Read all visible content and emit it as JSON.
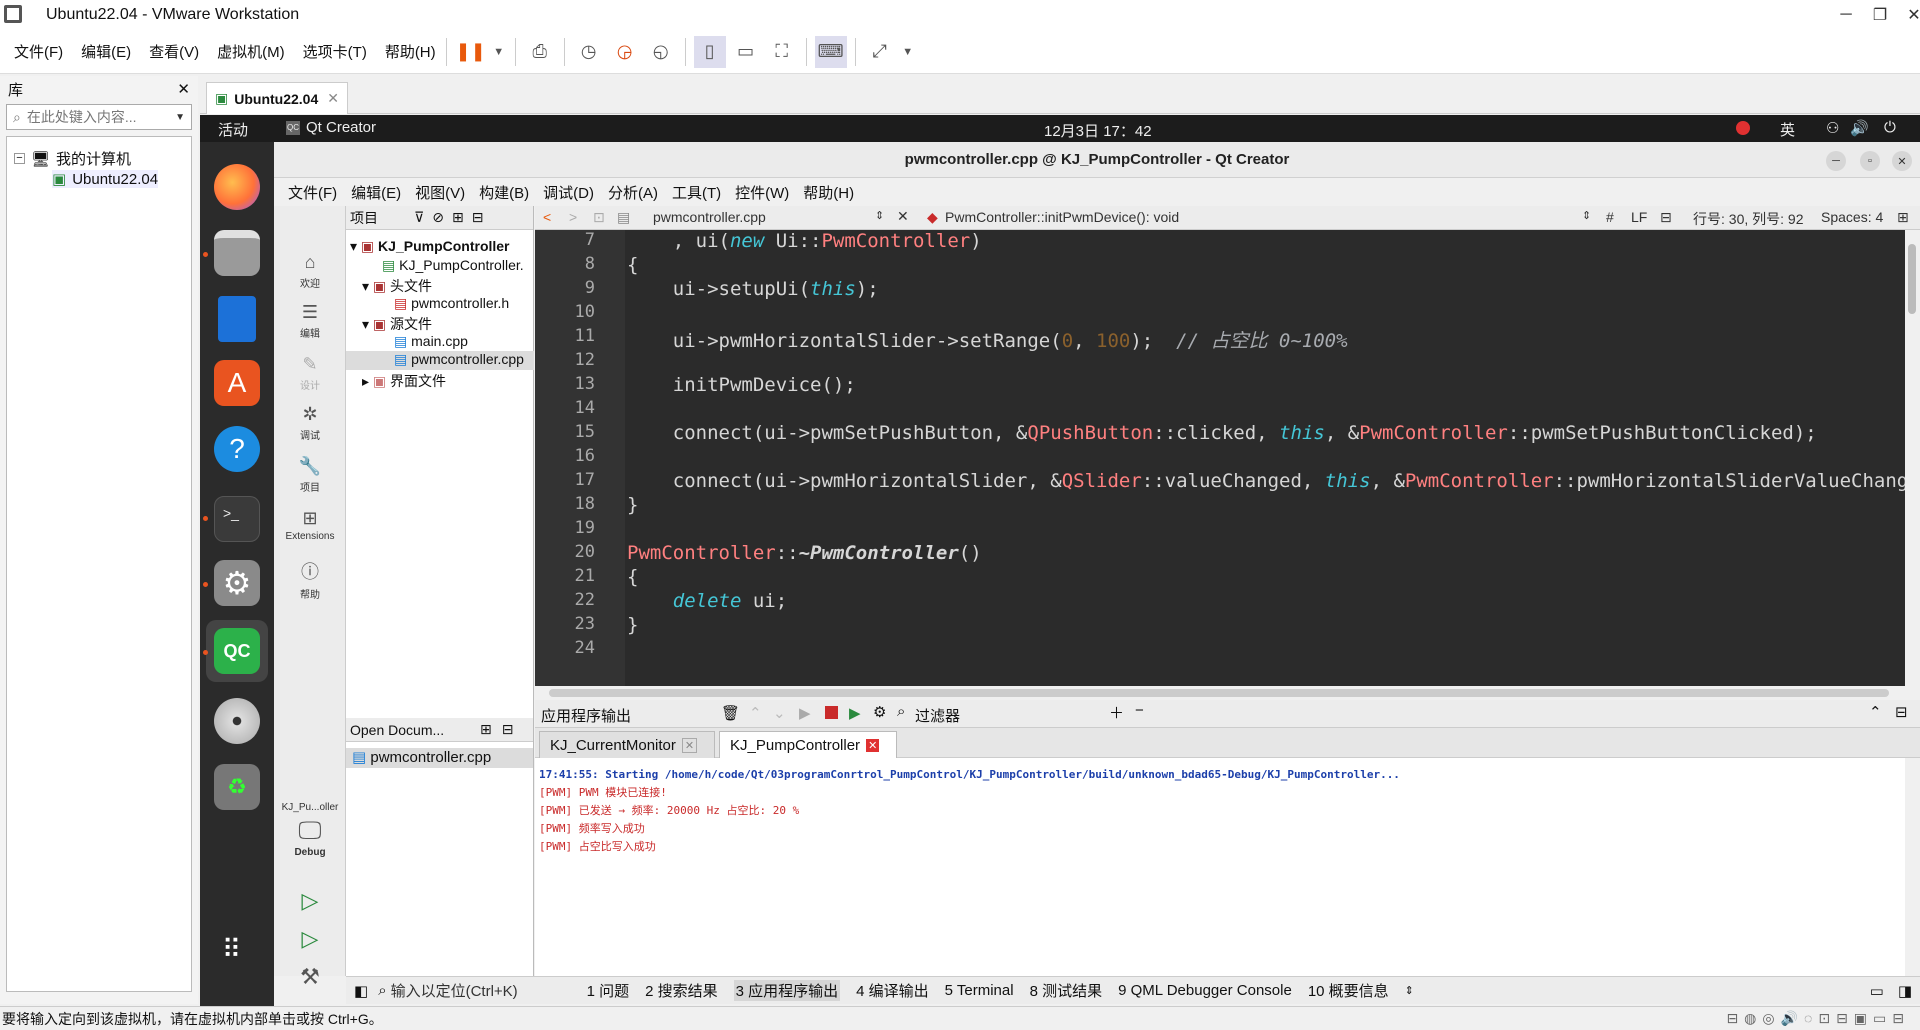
{
  "vmware": {
    "title": "Ubuntu22.04 - VMware Workstation",
    "menu": [
      "文件(F)",
      "编辑(E)",
      "查看(V)",
      "虚拟机(M)",
      "选项卡(T)",
      "帮助(H)"
    ],
    "library": {
      "title": "库",
      "search_placeholder": "在此处键入内容...",
      "tree_root": "我的计算机",
      "tree_child": "Ubuntu22.04"
    },
    "tab_label": "Ubuntu22.04",
    "status_text": "要将输入定向到该虚拟机，请在虚拟机内部单击或按 Ctrl+G。"
  },
  "gnome": {
    "activities": "活动",
    "app_name": "Qt Creator",
    "clock": "12月3日  17：42",
    "lang": "英"
  },
  "qt": {
    "title": "pwmcontroller.cpp @ KJ_PumpController - Qt Creator",
    "menu": [
      "文件(F)",
      "编辑(E)",
      "视图(V)",
      "构建(B)",
      "调试(D)",
      "分析(A)",
      "工具(T)",
      "控件(W)",
      "帮助(H)"
    ],
    "modes": [
      "欢迎",
      "编辑",
      "设计",
      "调试",
      "项目",
      "Extensions",
      "帮助"
    ],
    "project_label": "项目",
    "tree": {
      "root": "KJ_PumpController",
      "pro": "KJ_PumpController.",
      "headers": "头文件",
      "header_file": "pwmcontroller.h",
      "sources": "源文件",
      "main": "main.cpp",
      "pwmcpp": "pwmcontroller.cpp",
      "forms": "界面文件"
    },
    "open_docs_label": "Open Docum...",
    "open_doc": "pwmcontroller.cpp",
    "kit_name": "KJ_Pu...oller",
    "kit_mode": "Debug",
    "editor": {
      "file": "pwmcontroller.cpp",
      "symbol": "PwmController::initPwmDevice(): void",
      "hash": "#",
      "eol": "LF",
      "position": "行号: 30, 列号: 92",
      "spaces": "Spaces: 4"
    },
    "code": {
      "line_numbers": [
        "7",
        "8",
        "9",
        "10",
        "11",
        "12",
        "13",
        "14",
        "15",
        "16",
        "17",
        "18",
        "19",
        "20",
        "21",
        "22",
        "23",
        "24"
      ],
      "l7a": "    , ui(",
      "l7kw": "new",
      "l7b": " Ui::",
      "l7ty": "PwmController",
      "l7c": ")",
      "l8": "{",
      "l9a": "    ui->setupUi(",
      "l9kw": "this",
      "l9b": ");",
      "l11a": "    ui->pwmHorizontalSlider->setRange(",
      "l11n1": "0",
      "l11b": ", ",
      "l11n2": "100",
      "l11c": ");  ",
      "l11cm": "// 占空比 0~100%",
      "l13": "    initPwmDevice();",
      "l15a": "    connect(ui->pwmSetPushButton, &",
      "l15ty": "QPushButton",
      "l15b": "::clicked, ",
      "l15kw": "this",
      "l15c": ", &",
      "l15ty2": "PwmController",
      "l15d": "::pwmSetPushButtonClicked);",
      "l17a": "    connect(ui->pwmHorizontalSlider, &",
      "l17ty": "QSlider",
      "l17b": "::valueChanged, ",
      "l17kw": "this",
      "l17c": ", &",
      "l17ty2": "PwmController",
      "l17d": "::pwmHorizontalSliderValueChang",
      "l18": "}",
      "l20ty": "PwmController",
      "l20a": "::",
      "l20fn": "~PwmController",
      "l20b": "()",
      "l21": "{",
      "l22kw": "    delete",
      "l22a": " ui;",
      "l23": "}"
    },
    "output": {
      "pane_title": "应用程序输出",
      "filter": "过滤器",
      "tabs": [
        "KJ_CurrentMonitor",
        "KJ_PumpController"
      ],
      "lines": [
        "17:41:55: Starting /home/h/code/Qt/03programConrtrol_PumpControl/KJ_PumpController/build/unknown_bdad65-Debug/KJ_PumpController...",
        "[PWM] PWM 模块已连接!",
        "[PWM] 已发送 → 频率: 20000 Hz 占空比: 20 %",
        "[PWM] 频率写入成功",
        "[PWM] 占空比写入成功"
      ]
    },
    "locator_placeholder": "输入以定位(Ctrl+K)",
    "status_tabs": [
      "1 问题",
      "2 搜索结果",
      "3 应用程序输出",
      "4 编译输出",
      "5 Terminal",
      "8 测试结果",
      "9 QML Debugger Console",
      "10 概要信息"
    ]
  }
}
